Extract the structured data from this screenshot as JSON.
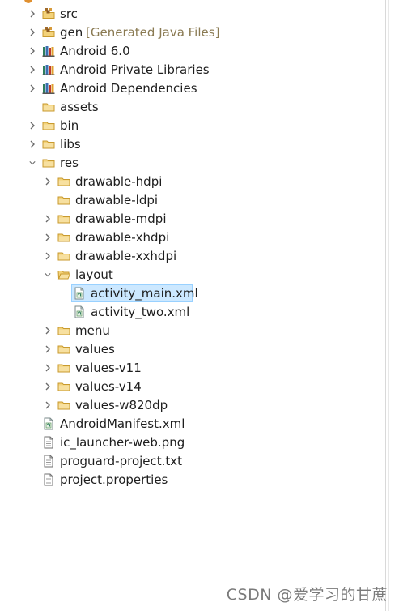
{
  "tree": [
    {
      "label": "src",
      "icon": "source-package-icon",
      "depth": 0,
      "state": "collapsed"
    },
    {
      "label": "gen",
      "decoration": "[Generated Java Files]",
      "icon": "source-package-icon",
      "depth": 0,
      "state": "collapsed"
    },
    {
      "label": "Android 6.0",
      "icon": "library-icon",
      "depth": 0,
      "state": "collapsed"
    },
    {
      "label": "Android Private Libraries",
      "icon": "library-icon",
      "depth": 0,
      "state": "collapsed"
    },
    {
      "label": "Android Dependencies",
      "icon": "library-icon",
      "depth": 0,
      "state": "collapsed"
    },
    {
      "label": "assets",
      "icon": "folder-icon",
      "depth": 0,
      "state": "none"
    },
    {
      "label": "bin",
      "icon": "folder-icon",
      "depth": 0,
      "state": "collapsed"
    },
    {
      "label": "libs",
      "icon": "folder-icon",
      "depth": 0,
      "state": "collapsed"
    },
    {
      "label": "res",
      "icon": "folder-icon",
      "depth": 0,
      "state": "expanded"
    },
    {
      "label": "drawable-hdpi",
      "icon": "folder-icon",
      "depth": 1,
      "state": "collapsed"
    },
    {
      "label": "drawable-ldpi",
      "icon": "folder-icon",
      "depth": 1,
      "state": "none"
    },
    {
      "label": "drawable-mdpi",
      "icon": "folder-icon",
      "depth": 1,
      "state": "collapsed"
    },
    {
      "label": "drawable-xhdpi",
      "icon": "folder-icon",
      "depth": 1,
      "state": "collapsed"
    },
    {
      "label": "drawable-xxhdpi",
      "icon": "folder-icon",
      "depth": 1,
      "state": "collapsed"
    },
    {
      "label": "layout",
      "icon": "folder-open-icon",
      "depth": 1,
      "state": "expanded"
    },
    {
      "label": "activity_main.xml",
      "icon": "xml-file-icon",
      "depth": 2,
      "state": "none",
      "selected": true
    },
    {
      "label": "activity_two.xml",
      "icon": "xml-file-icon",
      "depth": 2,
      "state": "none"
    },
    {
      "label": "menu",
      "icon": "folder-icon",
      "depth": 1,
      "state": "collapsed"
    },
    {
      "label": "values",
      "icon": "folder-icon",
      "depth": 1,
      "state": "collapsed"
    },
    {
      "label": "values-v11",
      "icon": "folder-icon",
      "depth": 1,
      "state": "collapsed"
    },
    {
      "label": "values-v14",
      "icon": "folder-icon",
      "depth": 1,
      "state": "collapsed"
    },
    {
      "label": "values-w820dp",
      "icon": "folder-icon",
      "depth": 1,
      "state": "collapsed"
    },
    {
      "label": "AndroidManifest.xml",
      "icon": "xml-file-icon",
      "depth": 0,
      "state": "none"
    },
    {
      "label": "ic_launcher-web.png",
      "icon": "file-icon",
      "depth": 0,
      "state": "none"
    },
    {
      "label": "proguard-project.txt",
      "icon": "file-icon",
      "depth": 0,
      "state": "none"
    },
    {
      "label": "project.properties",
      "icon": "file-icon",
      "depth": 0,
      "state": "none"
    }
  ],
  "colors": {
    "selection_bg": "#cce8ff",
    "decoration_text": "#8a7a52",
    "folder": "#e8b84a",
    "library": "#2e7d5b"
  },
  "watermark": "CSDN @爱学习的甘蔗"
}
